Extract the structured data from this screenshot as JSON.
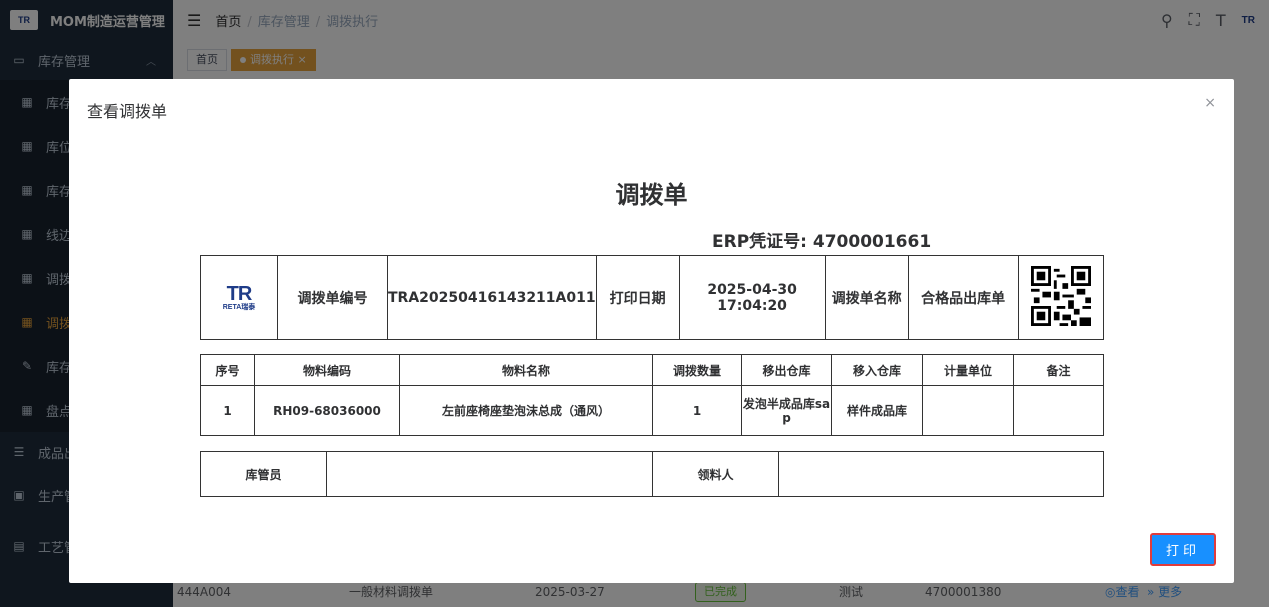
{
  "app": {
    "title": "MOM制造运营管理",
    "logo_text": "TR"
  },
  "sidebar": {
    "group_label": "库存管理",
    "items": [
      {
        "label": "库存"
      },
      {
        "label": "库位"
      },
      {
        "label": "库存"
      },
      {
        "label": "线边"
      },
      {
        "label": "调拨"
      },
      {
        "label": "调拨"
      },
      {
        "label": "库存"
      },
      {
        "label": "盘点"
      }
    ],
    "groups2": [
      {
        "label": "成品出"
      },
      {
        "label": "生产管"
      },
      {
        "label": "工艺管"
      }
    ]
  },
  "header": {
    "breadcrumb": [
      "首页",
      "库存管理",
      "调拨执行"
    ],
    "logo_text": "TR"
  },
  "tags": [
    {
      "label": "首页"
    },
    {
      "label": "调拨执行"
    }
  ],
  "bg_row": {
    "code": "444A004",
    "type": "一般材料调拨单",
    "date": "2025-03-27",
    "status": "已完成",
    "name": "测试",
    "erp": "4700001380",
    "view": "◎查看",
    "more": "» 更多"
  },
  "dialog": {
    "title": "查看调拨单",
    "close": "×",
    "doc_title": "调拨单",
    "erp_label": "ERP凭证号: 4700001661",
    "logo": {
      "big": "TR",
      "small": "RETA瑞泰"
    },
    "header_row": {
      "no_label": "调拨单编号",
      "no_value": "TRA20250416143211A011",
      "print_date_label": "打印日期",
      "print_date_value": "2025-04-30 17:04:20",
      "name_label": "调拨单名称",
      "name_value": "合格品出库单"
    },
    "items_table": {
      "headers": [
        "序号",
        "物料编码",
        "物料名称",
        "调拨数量",
        "移出仓库",
        "移入仓库",
        "计量单位",
        "备注"
      ],
      "rows": [
        [
          "1",
          "RH09-68036000",
          "左前座椅座垫泡沫总成（通风）",
          "1",
          "发泡半成品库sap",
          "样件成品库",
          "",
          ""
        ]
      ]
    },
    "sign_row": {
      "keeper_label": "库管员",
      "keeper_value": "",
      "receiver_label": "领料人",
      "receiver_value": ""
    },
    "print_label": "打印"
  }
}
